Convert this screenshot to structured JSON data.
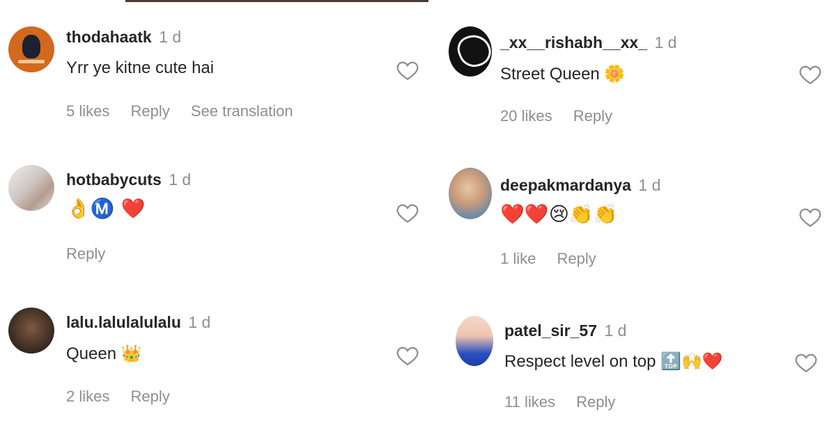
{
  "left_column": [
    {
      "username": "thodahaatk",
      "time": "1 d",
      "text": "Yrr ye kitne cute hai",
      "emojis": "",
      "likes": "5 likes",
      "reply": "Reply",
      "translation": "See translation",
      "avatar": "avatar-orange"
    },
    {
      "username": "hotbabycuts",
      "time": "1 d",
      "text": "",
      "emojis": "👌Ⓜ️ ❤️",
      "likes": "",
      "reply": "Reply",
      "translation": "",
      "avatar": "avatar-light"
    },
    {
      "username": "lalu.lalulalulalu",
      "time": "1 d",
      "text": "Queen 👑",
      "emojis": "",
      "likes": "2 likes",
      "reply": "Reply",
      "translation": "",
      "avatar": "avatar-dark"
    }
  ],
  "right_column": [
    {
      "username": "_xx__rishabh__xx_",
      "time": "1 d",
      "text": "Street Queen 🌼",
      "emojis": "",
      "likes": "20 likes",
      "reply": "Reply",
      "avatar": "avatar-black"
    },
    {
      "username": "deepakmardanya",
      "time": "1 d",
      "text": "",
      "emojis": "❤️❤️😢👏👏",
      "likes": "1 like",
      "reply": "Reply",
      "avatar": "avatar-baby"
    },
    {
      "username": "patel_sir_57",
      "time": "1 d",
      "text": "Respect level on top 🔝🙌❤️",
      "emojis": "",
      "likes": "11 likes",
      "reply": "Reply",
      "avatar": "avatar-patel"
    }
  ],
  "icons": {
    "like": "heart-outline-icon"
  }
}
